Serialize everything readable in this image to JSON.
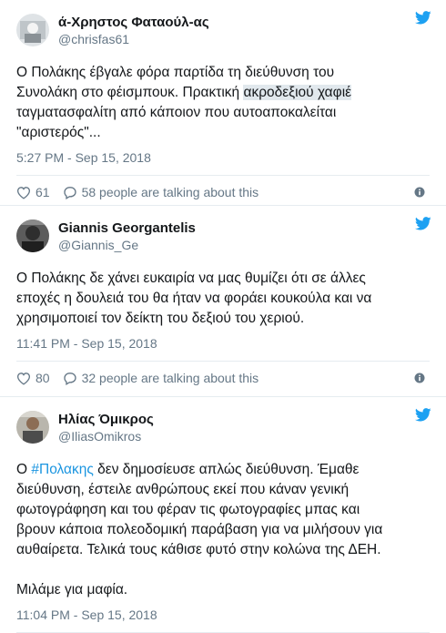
{
  "colors": {
    "twitter_blue": "#1da1f2",
    "secondary_text": "#657786",
    "link": "#1b95e0"
  },
  "tweets": [
    {
      "name": "ά-Χρηστος Φαταούλ-ας",
      "handle": "@chrisfas61",
      "text_a": "Ο Πολάκης έβγαλε φόρα παρτίδα τη διεύθυνση του\nΣυνολάκη στο φέισμπουκ. Πρακτική ",
      "text_hl": "ακροδεξιού χαφιέ",
      "text_b": "\nταγματασφαλίτη από κάποιον που αυτοαποκαλείται\n\"αριστερός\"...",
      "time": "5:27 PM - Sep 15, 2018",
      "likes": "61",
      "talking": "58 people are talking about this"
    },
    {
      "name": "Giannis Georgantelis",
      "handle": "@Giannis_Ge",
      "text": "Ο Πολάκης δε χάνει ευκαιρία να μας θυμίζει ότι σε άλλες\nεποχές η δουλειά του θα ήταν να φοράει κουκούλα και να\nχρησιμοποιεί τον δείκτη του δεξιού του χεριού.",
      "time": "11:41 PM - Sep 15, 2018",
      "likes": "80",
      "talking": "32 people are talking about this"
    },
    {
      "name": "Ηλίας Όμικρος",
      "handle": "@IliasOmikros",
      "text_pre": "Ο ",
      "hashtag": "#Πολακης",
      "text_post": " δεν δημοσίευσε απλώς διεύθυνση. Έμαθε\nδιεύθυνση, έστειλε ανθρώπους εκεί που κάναν γενική\nφωτογράφηση και του φέραν τις φωτογραφίες μπας και\nβρουν κάποια πολεοδομική παράβαση για να μιλήσουν για\nαυθαίρετα. Τελικά τους κάθισε φυτό στην κολώνα της ΔΕΗ.\n\nΜιλάμε για μαφία.",
      "time": "11:04 PM - Sep 15, 2018"
    }
  ]
}
